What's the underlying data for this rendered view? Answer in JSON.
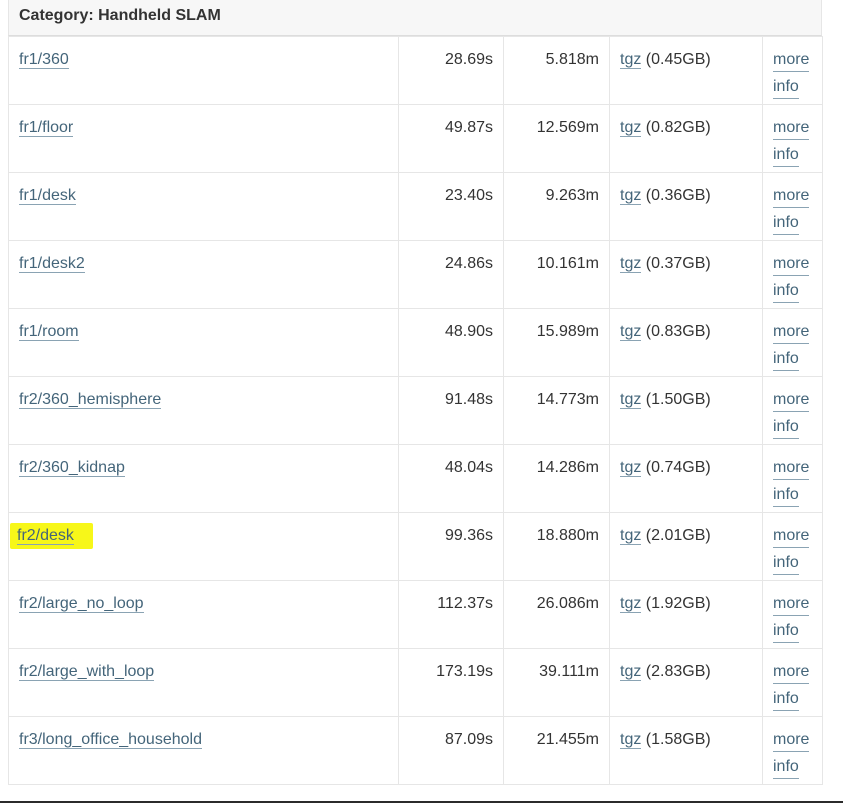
{
  "category": {
    "label": "Category: Handheld SLAM"
  },
  "rows": [
    {
      "name": "fr1/360",
      "duration": "28.69s",
      "length": "5.818m",
      "download": "tgz",
      "size": "(0.45GB)",
      "more": "more",
      "info": "info",
      "highlighted": false
    },
    {
      "name": "fr1/floor",
      "duration": "49.87s",
      "length": "12.569m",
      "download": "tgz",
      "size": "(0.82GB)",
      "more": "more",
      "info": "info",
      "highlighted": false
    },
    {
      "name": "fr1/desk",
      "duration": "23.40s",
      "length": "9.263m",
      "download": "tgz",
      "size": "(0.36GB)",
      "more": "more",
      "info": "info",
      "highlighted": false
    },
    {
      "name": "fr1/desk2",
      "duration": "24.86s",
      "length": "10.161m",
      "download": "tgz",
      "size": "(0.37GB)",
      "more": "more",
      "info": "info",
      "highlighted": false
    },
    {
      "name": "fr1/room",
      "duration": "48.90s",
      "length": "15.989m",
      "download": "tgz",
      "size": "(0.83GB)",
      "more": "more",
      "info": "info",
      "highlighted": false
    },
    {
      "name": "fr2/360_hemisphere",
      "duration": "91.48s",
      "length": "14.773m",
      "download": "tgz",
      "size": "(1.50GB)",
      "more": "more",
      "info": "info",
      "highlighted": false
    },
    {
      "name": "fr2/360_kidnap",
      "duration": "48.04s",
      "length": "14.286m",
      "download": "tgz",
      "size": "(0.74GB)",
      "more": "more",
      "info": "info",
      "highlighted": false
    },
    {
      "name": "fr2/desk",
      "duration": "99.36s",
      "length": "18.880m",
      "download": "tgz",
      "size": "(2.01GB)",
      "more": "more",
      "info": "info",
      "highlighted": true
    },
    {
      "name": "fr2/large_no_loop",
      "duration": "112.37s",
      "length": "26.086m",
      "download": "tgz",
      "size": "(1.92GB)",
      "more": "more",
      "info": "info",
      "highlighted": false
    },
    {
      "name": "fr2/large_with_loop",
      "duration": "173.19s",
      "length": "39.111m",
      "download": "tgz",
      "size": "(2.83GB)",
      "more": "more",
      "info": "info",
      "highlighted": false
    },
    {
      "name": "fr3/long_office_household",
      "duration": "87.09s",
      "length": "21.455m",
      "download": "tgz",
      "size": "(1.58GB)",
      "more": "more",
      "info": "info",
      "highlighted": false
    }
  ],
  "colors": {
    "link": "#44657a",
    "highlight": "#f7f719",
    "border": "#e6e6e6"
  }
}
